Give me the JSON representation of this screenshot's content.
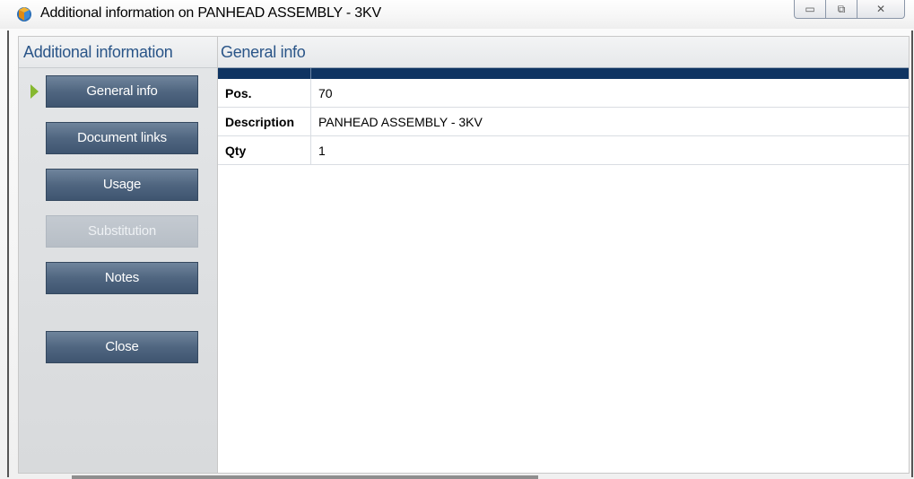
{
  "window": {
    "title": "Additional information on PANHEAD ASSEMBLY - 3KV",
    "controls": {
      "minimize": "▭",
      "maximize": "⧉",
      "close": "✕"
    }
  },
  "sidebar": {
    "header": "Additional information",
    "items": [
      {
        "label": "General info",
        "selected": true
      },
      {
        "label": "Document links"
      },
      {
        "label": "Usage"
      },
      {
        "label": "Substitution",
        "disabled": true
      },
      {
        "label": "Notes"
      }
    ],
    "close_label": "Close"
  },
  "main": {
    "header": "General info",
    "rows": [
      {
        "key": "Pos.",
        "value": "70"
      },
      {
        "key": "Description",
        "value": "PANHEAD ASSEMBLY - 3KV"
      },
      {
        "key": "Qty",
        "value": "1"
      }
    ]
  },
  "colors": {
    "accent_header_text": "#2a5588",
    "button_bg": "#506680",
    "grid_header": "#0f3462",
    "selection_arrow": "#86b830"
  }
}
